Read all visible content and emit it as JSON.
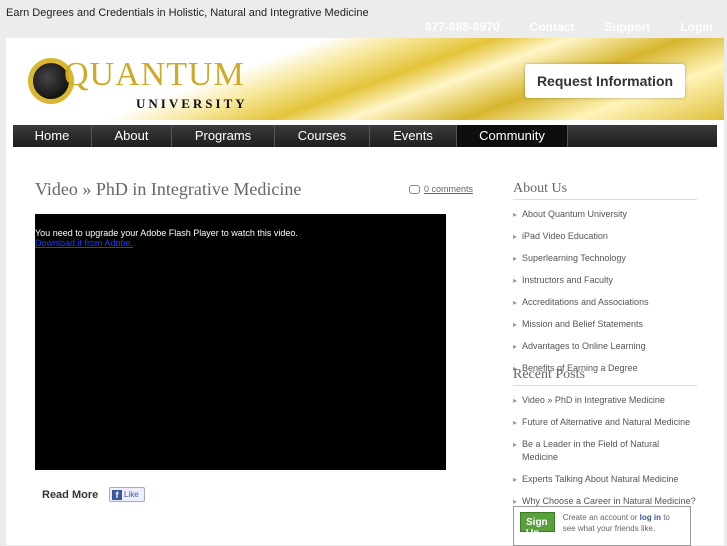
{
  "tagline": "Earn Degrees and Credentials in Holistic, Natural and Integrative Medicine",
  "toplinks": [
    "877-888-8970",
    "Contact",
    "Support",
    "Login"
  ],
  "logo": {
    "name": "QUANTUM",
    "sub": "UNIVERSITY"
  },
  "request_button": "Request Information",
  "nav": [
    "Home",
    "About",
    "Programs",
    "Courses",
    "Events",
    "Community"
  ],
  "post": {
    "title": "Video » PhD in Integrative Medicine",
    "comments": "0 comments",
    "flash_msg": "You need to upgrade your Adobe Flash Player to watch this video.",
    "flash_link": "Download it from Adobe.",
    "read_more": "Read More",
    "like": "Like"
  },
  "about": {
    "heading": "About Us",
    "items": [
      "About Quantum University",
      "iPad Video Education",
      "Superlearning Technology",
      "Instructors and Faculty",
      "Accreditations and Associations",
      "Mission and Belief Statements",
      "Advantages to Online Learning",
      "Benefits of Earning a Degree"
    ]
  },
  "recent": {
    "heading": "Recent Posts",
    "items": [
      "Video » PhD in Integrative Medicine",
      "Future of Alternative and Natural Medicine",
      "Be a Leader in the Field of Natural Medicine",
      "Experts Talking About Natural Medicine",
      "Why Choose a Career in Natural Medicine?"
    ]
  },
  "facebook": {
    "signup": "Sign Up",
    "text1": "Create an account or ",
    "login": "log in",
    "text2": " to see what your friends like."
  }
}
